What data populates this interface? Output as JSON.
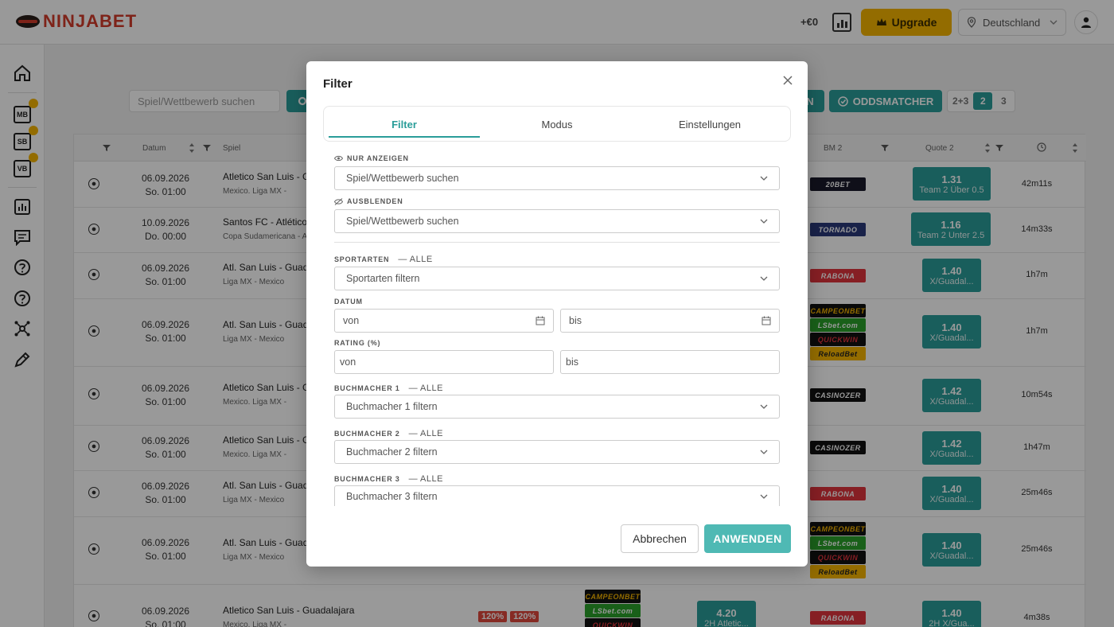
{
  "brand": {
    "name": "NINJABET",
    "color": "#d23b2a"
  },
  "header": {
    "balance": "+€0",
    "upgrade_label": "Upgrade",
    "country": "Deutschland"
  },
  "sidebar": {
    "items": [
      {
        "icon": "home-icon"
      },
      {
        "icon": "mb-icon",
        "label": "MB"
      },
      {
        "icon": "sb-icon",
        "label": "SB"
      },
      {
        "icon": "vb-icon",
        "label": "VB"
      },
      {
        "icon": "chart-icon"
      },
      {
        "icon": "chat-icon"
      },
      {
        "icon": "help-icon"
      },
      {
        "icon": "help-icon-2"
      },
      {
        "icon": "network-icon"
      },
      {
        "icon": "edit-icon"
      }
    ]
  },
  "toolbar": {
    "search_placeholder": "Spiel/Wettbewerb suchen",
    "btn_partial": "N",
    "oddsmatcher_label": "ODDSMATCHER",
    "pages": [
      "2+3",
      "2",
      "3"
    ],
    "active_page": "2"
  },
  "table": {
    "headers": {
      "datum": "Datum",
      "spiel": "Spiel",
      "bm2": "BM 2",
      "quote2": "Quote 2"
    },
    "rows": [
      {
        "date": "06.09.2026",
        "time": "So. 01:00",
        "game": "Atletico San Luis - Gu",
        "league": "Mexico. Liga MX -",
        "bm": [
          {
            "name": "20BET",
            "bg": "#1a1a2a",
            "fg": "#fff"
          }
        ],
        "odd": "1.31",
        "odd_label": "Team 2 Über 0.5",
        "countdown": "42m11s"
      },
      {
        "date": "10.09.2026",
        "time": "Do. 00:00",
        "game": "Santos FC - Atlético M",
        "league": "Copa Sudamericana - A",
        "bm": [
          {
            "name": "TORNADO",
            "bg": "#2a3a7a",
            "fg": "#fff"
          }
        ],
        "odd": "1.16",
        "odd_label": "Team 2 Unter 2.5",
        "countdown": "14m33s"
      },
      {
        "date": "06.09.2026",
        "time": "So. 01:00",
        "game": "Atl. San Luis - Guadal",
        "league": "Liga MX - Mexico",
        "bm": [
          {
            "name": "RABONA",
            "bg": "#e0343c",
            "fg": "#fff"
          }
        ],
        "odd": "1.40",
        "odd_label": "X/Guadal...",
        "countdown": "1h7m"
      },
      {
        "date": "06.09.2026",
        "time": "So. 01:00",
        "game": "Atl. San Luis - Guadal",
        "league": "Liga MX - Mexico",
        "bm": [
          {
            "name": "CAMPEONBET",
            "bg": "#111",
            "fg": "#f5b400"
          },
          {
            "name": "LSbet.com",
            "bg": "#2aa02a",
            "fg": "#fff"
          },
          {
            "name": "QUICKWIN",
            "bg": "#111",
            "fg": "#e0343c"
          },
          {
            "name": "ReloadBet",
            "bg": "#f5b400",
            "fg": "#222"
          }
        ],
        "odd": "1.40",
        "odd_label": "X/Guadal...",
        "countdown": "1h7m"
      },
      {
        "date": "06.09.2026",
        "time": "So. 01:00",
        "game": "Atletico San Luis - Gu",
        "league": "Mexico. Liga MX -",
        "bm": [
          {
            "name": "CASINOZER",
            "bg": "#111",
            "fg": "#fff"
          }
        ],
        "odd": "1.42",
        "odd_label": "X/Guadal...",
        "countdown": "10m54s"
      },
      {
        "date": "06.09.2026",
        "time": "So. 01:00",
        "game": "Atletico San Luis - Gu",
        "league": "Mexico. Liga MX -",
        "bm": [
          {
            "name": "CASINOZER",
            "bg": "#111",
            "fg": "#fff"
          }
        ],
        "odd": "1.42",
        "odd_label": "X/Guadal...",
        "countdown": "1h47m"
      },
      {
        "date": "06.09.2026",
        "time": "So. 01:00",
        "game": "Atl. San Luis - Guadal",
        "league": "Liga MX - Mexico",
        "bm": [
          {
            "name": "RABONA",
            "bg": "#e0343c",
            "fg": "#fff"
          }
        ],
        "odd": "1.40",
        "odd_label": "X/Guadal...",
        "countdown": "25m46s"
      },
      {
        "date": "06.09.2026",
        "time": "So. 01:00",
        "game": "Atl. San Luis - Guadal",
        "league": "Liga MX - Mexico",
        "bm": [
          {
            "name": "CAMPEONBET",
            "bg": "#111",
            "fg": "#f5b400"
          },
          {
            "name": "LSbet.com",
            "bg": "#2aa02a",
            "fg": "#fff"
          },
          {
            "name": "QUICKWIN",
            "bg": "#111",
            "fg": "#e0343c"
          },
          {
            "name": "ReloadBet",
            "bg": "#f5b400",
            "fg": "#222"
          }
        ],
        "odd": "1.40",
        "odd_label": "X/Guadal...",
        "countdown": "25m46s"
      },
      {
        "date": "06.09.2026",
        "time": "So. 01:00",
        "game": "Atletico San Luis - Guadalajara",
        "league": "Mexico. Liga MX -",
        "rating": [
          "120%",
          "120%"
        ],
        "bm1": [
          {
            "name": "CAMPEONBET",
            "bg": "#111",
            "fg": "#f5b400"
          },
          {
            "name": "LSbet.com",
            "bg": "#2aa02a",
            "fg": "#fff"
          },
          {
            "name": "QUICKWIN",
            "bg": "#111",
            "fg": "#e0343c"
          }
        ],
        "odd1": "4.20",
        "odd1_label": "2H Atletic...",
        "bm": [
          {
            "name": "RABONA",
            "bg": "#e0343c",
            "fg": "#fff"
          }
        ],
        "odd": "1.40",
        "odd_label": "2H X/Gua...",
        "countdown": "4m38s"
      }
    ]
  },
  "modal": {
    "title": "Filter",
    "tabs": [
      "Filter",
      "Modus",
      "Einstellungen"
    ],
    "active_tab": "Filter",
    "nur_anzeigen_label": "NUR ANZEIGEN",
    "nur_anzeigen_placeholder": "Spiel/Wettbewerb suchen",
    "ausblenden_label": "AUSBLENDEN",
    "ausblenden_placeholder": "Spiel/Wettbewerb suchen",
    "sportarten_label": "SPORTARTEN",
    "sportarten_extra": "— ALLE",
    "sportarten_placeholder": "Sportarten filtern",
    "datum_label": "DATUM",
    "datum_from": "von",
    "datum_to": "bis",
    "rating_label": "RATING (%)",
    "rating_from": "von",
    "rating_to": "bis",
    "bm1_label": "BUCHMACHER 1",
    "bm1_extra": "— ALLE",
    "bm1_placeholder": "Buchmacher 1 filtern",
    "bm2_label": "BUCHMACHER 2",
    "bm2_extra": "— ALLE",
    "bm2_placeholder": "Buchmacher 2 filtern",
    "bm3_label": "BUCHMACHER 3",
    "bm3_extra": "— ALLE",
    "bm3_placeholder": "Buchmacher 3 filtern",
    "cancel_label": "Abbrechen",
    "apply_label": "ANWENDEN"
  },
  "colors": {
    "accent": "#2a9d99",
    "upgrade": "#f5b400",
    "danger": "#e0483d"
  }
}
